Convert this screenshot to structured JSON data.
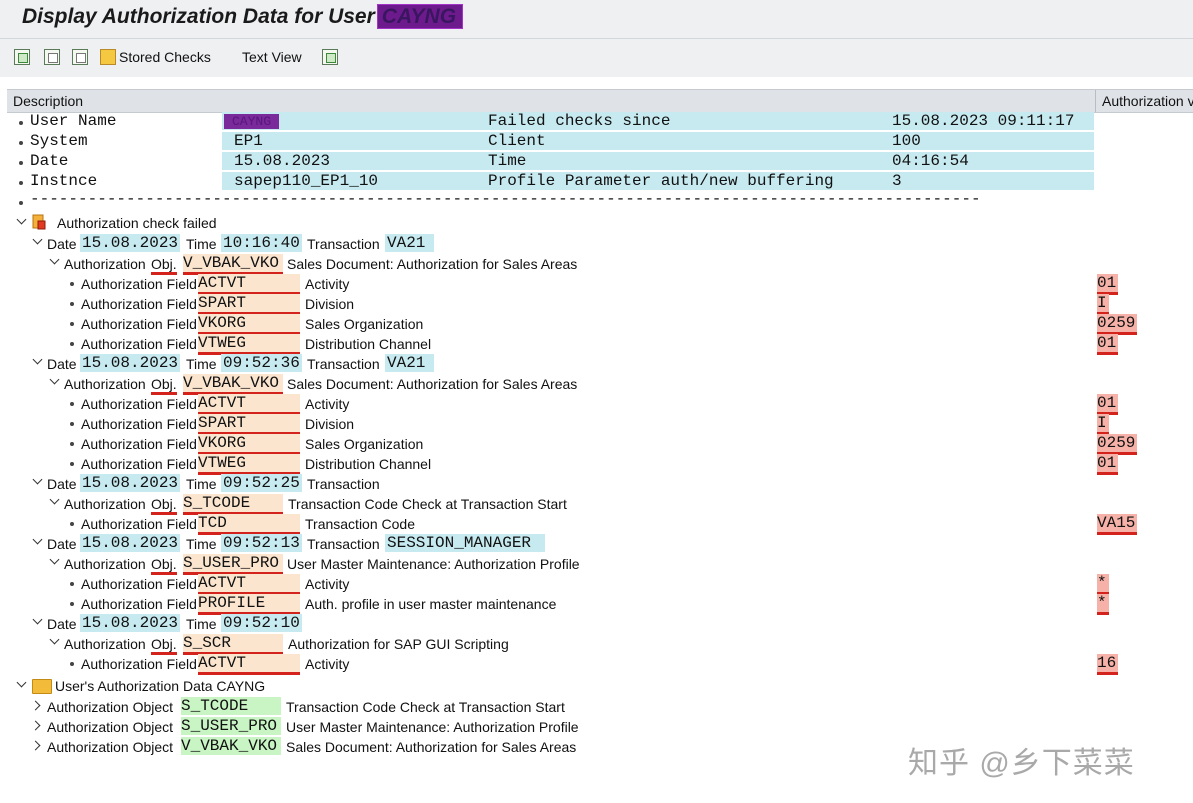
{
  "window": {
    "title_prefix": "Display Authorization Data for User",
    "title_user": "CAYNG"
  },
  "toolbar": {
    "stored_checks": "Stored Checks",
    "text_view": "Text View"
  },
  "columns": {
    "description": "Description",
    "authorization": "Authorization value"
  },
  "summary": {
    "rows": [
      {
        "label": "User Name",
        "value": "CAYNG",
        "label2": "Failed checks since",
        "value2": "15.08.2023 09:11:17"
      },
      {
        "label": "System",
        "value": "EP1",
        "label2": "Client",
        "value2": "100"
      },
      {
        "label": "Date",
        "value": "15.08.2023",
        "label2": "Time",
        "value2": "04:16:54"
      },
      {
        "label": "Instnce",
        "value": "sapep110_EP1_10",
        "label2": "Profile Parameter auth/new buffering",
        "value2": "3"
      }
    ],
    "separator": "---------------------------------------------------------------------------------------------------------------------------"
  },
  "failed": {
    "label": "Authorization check failed",
    "date_label": "Date",
    "time_label": "Time",
    "trans_label": "Transaction",
    "auth_label": "Authorization",
    "obj_label": "Obj.",
    "field_label": "Authorization Field",
    "checks": [
      {
        "date": "15.08.2023",
        "time": "10:16:40",
        "transaction": "VA21",
        "object": "V_VBAK_VKO",
        "object_desc": "Sales Document: Authorization for Sales Areas",
        "fields": [
          {
            "name": "ACTVT",
            "desc": "Activity",
            "value": "01"
          },
          {
            "name": "SPART",
            "desc": "Division",
            "value": "I"
          },
          {
            "name": "VKORG",
            "desc": "Sales Organization",
            "value": "0259"
          },
          {
            "name": "VTWEG",
            "desc": "Distribution Channel",
            "value": "01"
          }
        ]
      },
      {
        "date": "15.08.2023",
        "time": "09:52:36",
        "transaction": "VA21",
        "object": "V_VBAK_VKO",
        "object_desc": "Sales Document: Authorization for Sales Areas",
        "fields": [
          {
            "name": "ACTVT",
            "desc": "Activity",
            "value": "01"
          },
          {
            "name": "SPART",
            "desc": "Division",
            "value": "I"
          },
          {
            "name": "VKORG",
            "desc": "Sales Organization",
            "value": "0259"
          },
          {
            "name": "VTWEG",
            "desc": "Distribution Channel",
            "value": "01"
          }
        ]
      },
      {
        "date": "15.08.2023",
        "time": "09:52:25",
        "transaction": "",
        "object": "S_TCODE",
        "object_desc": "Transaction Code Check at Transaction Start",
        "fields": [
          {
            "name": "TCD",
            "desc": "Transaction Code",
            "value": "VA15"
          }
        ]
      },
      {
        "date": "15.08.2023",
        "time": "09:52:13",
        "transaction": "SESSION_MANAGER",
        "object": "S_USER_PRO",
        "object_desc": "User Master Maintenance: Authorization Profile",
        "fields": [
          {
            "name": "ACTVT",
            "desc": "Activity",
            "value": "*"
          },
          {
            "name": "PROFILE",
            "desc": "Auth. profile in user master maintenance",
            "value": "*"
          }
        ]
      },
      {
        "date": "15.08.2023",
        "time": "09:52:10",
        "transaction": null,
        "object": "S_SCR",
        "object_desc": "Authorization for SAP GUI Scripting",
        "fields": [
          {
            "name": "ACTVT",
            "desc": "Activity",
            "value": "16"
          }
        ]
      }
    ]
  },
  "user_data": {
    "label": "User's Authorization Data CAYNG",
    "object_label": "Authorization Object",
    "objects": [
      {
        "name": "S_TCODE",
        "desc": "Transaction Code Check at Transaction Start"
      },
      {
        "name": "S_USER_PRO",
        "desc": "User Master Maintenance: Authorization Profile"
      },
      {
        "name": "V_VBAK_VKO",
        "desc": "Sales Document: Authorization for Sales Areas"
      }
    ]
  },
  "watermark": "知乎 @乡下菜菜"
}
